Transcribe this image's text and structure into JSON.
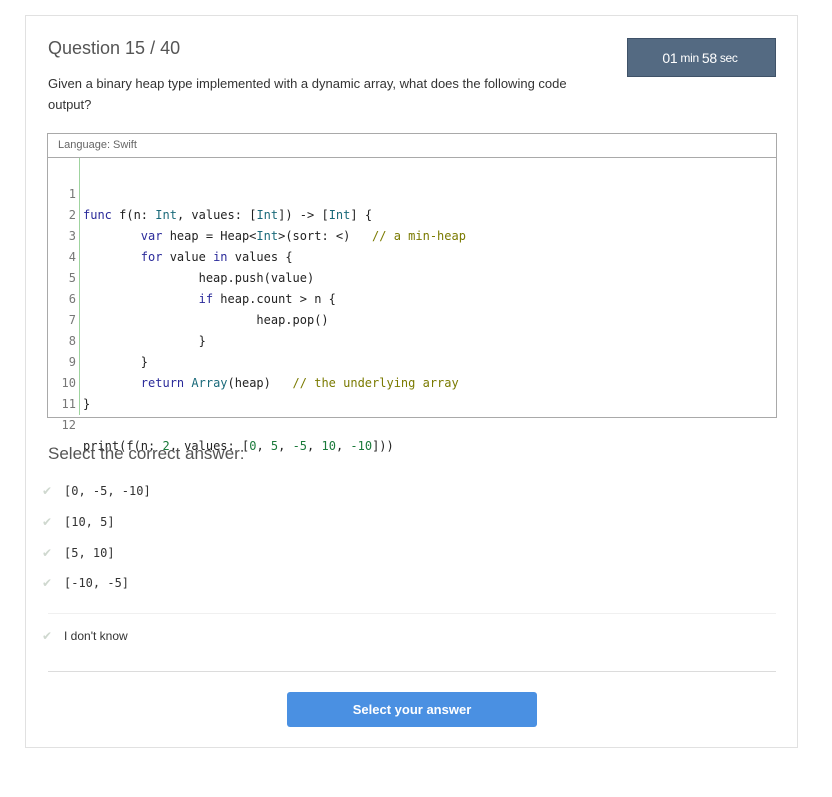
{
  "question": {
    "title": "Question 15 / 40",
    "prompt": "Given a binary heap type implemented with a dynamic array, what does the following code output?"
  },
  "timer": {
    "minutes": "01",
    "min_label": "min",
    "seconds": "58",
    "sec_label": "sec"
  },
  "code": {
    "language_label": "Language: Swift",
    "line_numbers": [
      "1",
      "2",
      "3",
      "4",
      "5",
      "6",
      "7",
      "8",
      "9",
      "10",
      "11",
      "12"
    ]
  },
  "answers": {
    "heading": "Select the correct answer:",
    "options": [
      "[0, -5, -10]",
      "[10, 5]",
      "[5, 10]",
      "[-10, -5]"
    ],
    "dont_know": "I don't know"
  },
  "submit": {
    "label": "Select your answer"
  }
}
